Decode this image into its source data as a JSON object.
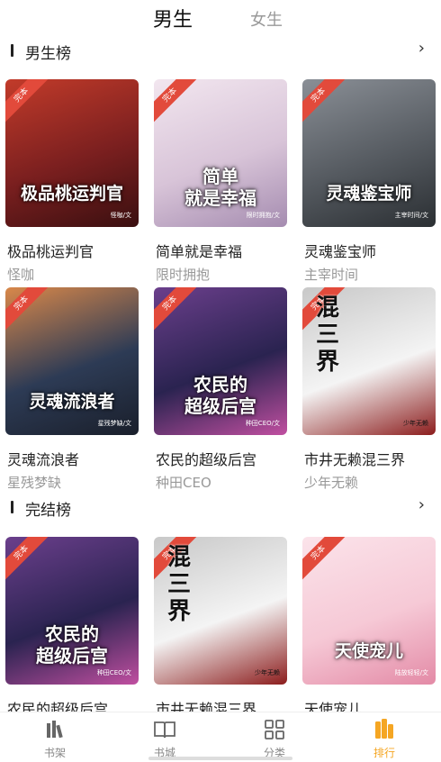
{
  "tabs": {
    "male": "男生",
    "female": "女生"
  },
  "sections": [
    {
      "title": "男生榜",
      "more": "›"
    },
    {
      "title": "完结榜",
      "more": "›"
    }
  ],
  "books": [
    {
      "title": "极品桃运判官",
      "author": "怪咖",
      "cover_title": "极品桃运判官",
      "cover_author": "怪咖/文",
      "ribbon": "完本",
      "colors": [
        "#7a1f1f",
        "#c23b2a",
        "#3a0f10"
      ]
    },
    {
      "title": "简单就是幸福",
      "author": "限时拥抱",
      "cover_title": "简单\n就是幸福",
      "cover_author": "限时拥抱/文",
      "ribbon": "完本",
      "colors": [
        "#d8c4d8",
        "#f2e6ef",
        "#a58cb0"
      ]
    },
    {
      "title": "灵魂鉴宝师",
      "author": "主宰时间",
      "cover_title": "灵魂鉴宝师",
      "cover_author": "主宰时间/文",
      "ribbon": "完本",
      "colors": [
        "#555a60",
        "#8a8f96",
        "#2b2f33"
      ]
    },
    {
      "title": "灵魂流浪者",
      "author": "星残梦缺",
      "cover_title": "灵魂流浪者",
      "cover_author": "星残梦缺/文",
      "ribbon": "完本",
      "colors": [
        "#2d3b55",
        "#d9884a",
        "#1a1f2b"
      ]
    },
    {
      "title": "农民的超级后宫",
      "author": "种田CEO",
      "cover_title": "农民的\n超级后宫",
      "cover_author": "种田CEO/文",
      "ribbon": "完本",
      "colors": [
        "#2a2350",
        "#6b3f8c",
        "#c04fa0"
      ]
    },
    {
      "title": "市井无赖混三界",
      "author": "少年无赖",
      "cover_title": "混\n三\n界",
      "cover_author": "少年无赖",
      "ribbon": "完本",
      "colors": [
        "#f4f4f4",
        "#c8c8c8",
        "#8c1d1d"
      ]
    },
    {
      "title": "农民的超级后宫",
      "author": "",
      "cover_title": "农民的\n超级后宫",
      "cover_author": "种田CEO/文",
      "ribbon": "完本",
      "colors": [
        "#2a2350",
        "#6b3f8c",
        "#c04fa0"
      ]
    },
    {
      "title": "市井无赖混三界",
      "author": "",
      "cover_title": "混\n三\n界",
      "cover_author": "少年无赖",
      "ribbon": "完本",
      "colors": [
        "#f4f4f4",
        "#c8c8c8",
        "#8c1d1d"
      ]
    },
    {
      "title": "天使宠儿",
      "author": "",
      "cover_title": "天使宠儿",
      "cover_author": "陆放轻轻/文",
      "ribbon": "完本",
      "colors": [
        "#f6c9d6",
        "#fbe3ea",
        "#e38aa6"
      ]
    }
  ],
  "nav": [
    {
      "label": "书架",
      "icon": "bookshelf-icon"
    },
    {
      "label": "书城",
      "icon": "open-book-icon"
    },
    {
      "label": "分类",
      "icon": "category-grid-icon"
    },
    {
      "label": "排行",
      "icon": "ranking-icon",
      "active": true
    }
  ],
  "accent": "#f5a623"
}
